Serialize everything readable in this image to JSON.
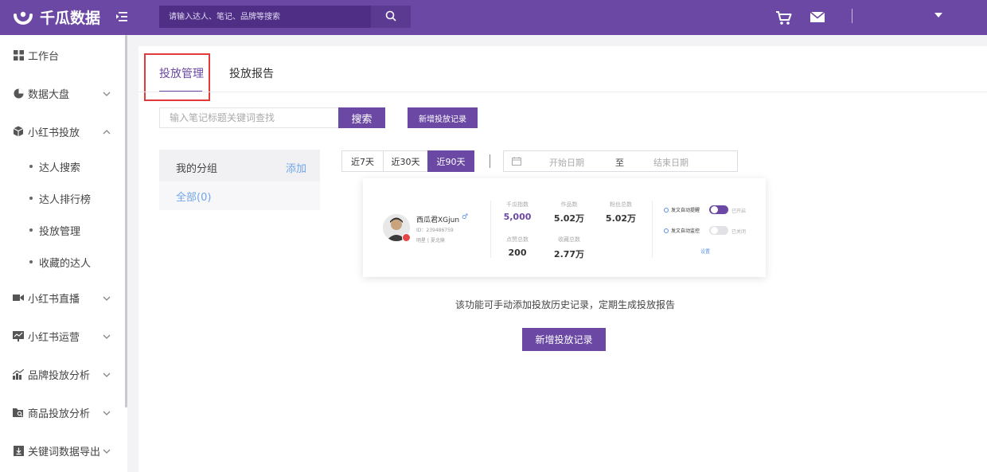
{
  "brand": {
    "name": "千瓜数据",
    "primary_color": "#6a48a3"
  },
  "topbar": {
    "search_placeholder": "请输入达人、笔记、品牌等搜索",
    "icons": [
      "menu-toggle-icon",
      "search-icon",
      "cart-icon",
      "mail-icon",
      "caret-down-icon"
    ]
  },
  "sidebar": {
    "items": [
      {
        "label": "工作台",
        "icon": "dashboard-icon"
      },
      {
        "label": "数据大盘",
        "icon": "pie-chart-icon"
      },
      {
        "label": "小红书投放",
        "icon": "box-icon",
        "expanded": true
      },
      {
        "label": "小红书直播",
        "icon": "video-icon"
      },
      {
        "label": "小红书运营",
        "icon": "chart-board-icon"
      },
      {
        "label": "品牌投放分析",
        "icon": "bar-trend-icon"
      },
      {
        "label": "商品投放分析",
        "icon": "folder-search-icon"
      },
      {
        "label": "关键词数据导出",
        "icon": "download-icon"
      }
    ],
    "sub_items": [
      {
        "label": "达人搜索"
      },
      {
        "label": "达人排行榜"
      },
      {
        "label": "投放管理",
        "active": true
      },
      {
        "label": "收藏的达人"
      }
    ]
  },
  "main": {
    "tabs": [
      {
        "label": "投放管理",
        "active": true
      },
      {
        "label": "投放报告"
      }
    ],
    "search": {
      "placeholder": "输入笔记标题关键词查找",
      "button_label": "搜索"
    },
    "add_record_label": "新增投放记录",
    "group": {
      "title": "我的分组",
      "add_label": "添加",
      "all_label": "全部(0)"
    },
    "ranges": [
      {
        "label": "近7天"
      },
      {
        "label": "近30天"
      },
      {
        "label": "近90天",
        "active": true
      }
    ],
    "date": {
      "start_placeholder": "开始日期",
      "to_label": "至",
      "end_placeholder": "结束日期"
    },
    "preview_card": {
      "name": "西瓜君XGjun",
      "gender_icon": "male-icon",
      "id": "ID：239486759",
      "tags": "明星 | 夏北鼎",
      "stats": [
        {
          "label": "千瓜指数",
          "value": "5,000"
        },
        {
          "label": "作品数",
          "value": "5.02万"
        },
        {
          "label": "粉丝总数",
          "value": "5.02万"
        },
        {
          "label": "点赞总数",
          "value": "200"
        },
        {
          "label": "收藏总数",
          "value": "2.77万"
        }
      ],
      "settings": [
        {
          "label": "发文自动提醒",
          "state": "已开启",
          "on": true
        },
        {
          "label": "发文自动监控",
          "state": "已关闭",
          "on": false
        }
      ],
      "link_label": "设置"
    },
    "hint": "该功能可手动添加投放历史记录，定期生成投放报告",
    "cta_label": "新增投放记录"
  }
}
